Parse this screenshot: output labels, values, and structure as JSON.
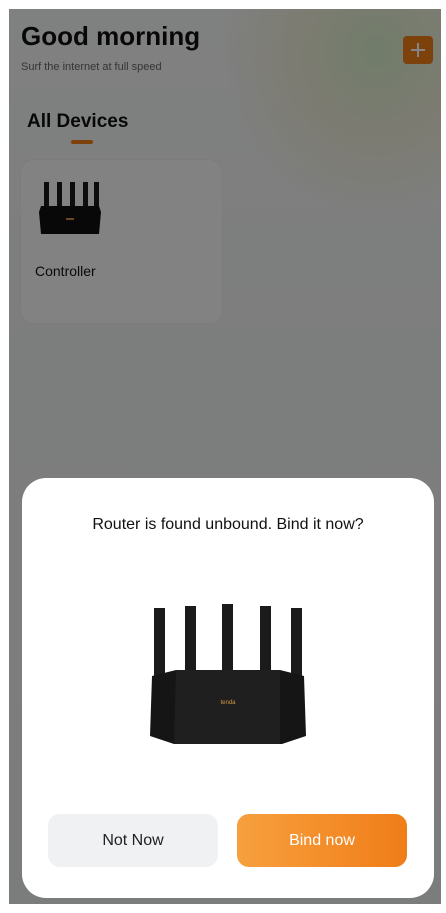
{
  "header": {
    "greeting": "Good morning",
    "subtitle": "Surf the internet at full speed",
    "add_icon": "plus-icon"
  },
  "tabs": [
    {
      "label": "All Devices",
      "active": true
    }
  ],
  "devices": [
    {
      "name": "Controller",
      "icon": "router-icon"
    }
  ],
  "dialog": {
    "message": "Router is found unbound. Bind it now?",
    "image": "router-image",
    "brand": "tenda",
    "secondary_label": "Not Now",
    "primary_label": "Bind now"
  },
  "colors": {
    "accent": "#f07d18",
    "accent_light": "#f7a03e",
    "secondary_button": "#f0f1f3",
    "overlay": "rgba(0,0,0,0.48)"
  }
}
